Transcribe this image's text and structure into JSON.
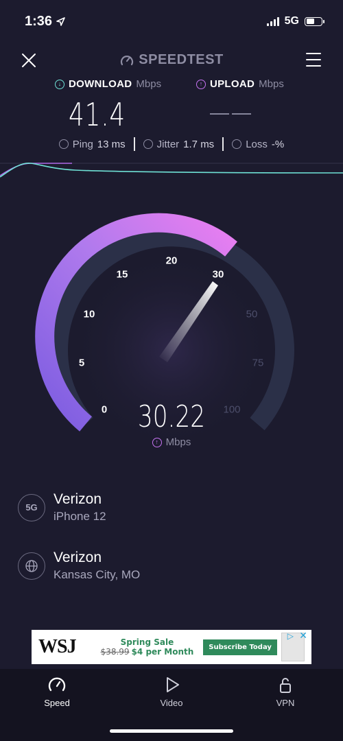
{
  "status_bar": {
    "time": "1:36",
    "network": "5G"
  },
  "header": {
    "app_name": "SPEEDTEST"
  },
  "download": {
    "label": "DOWNLOAD",
    "unit": "Mbps",
    "value": "41.4"
  },
  "upload": {
    "label": "UPLOAD",
    "unit": "Mbps",
    "value": "——"
  },
  "stats": {
    "ping_label": "Ping",
    "ping_value": "13 ms",
    "jitter_label": "Jitter",
    "jitter_value": "1.7 ms",
    "loss_label": "Loss",
    "loss_value": "-%"
  },
  "gauge": {
    "ticks": [
      "0",
      "5",
      "10",
      "15",
      "20",
      "30",
      "50",
      "75",
      "100"
    ],
    "current_speed": "30.22",
    "unit": "Mbps",
    "accent_start": "#7b5ce0",
    "accent_end": "#e879f0",
    "track_color": "#2b3048"
  },
  "connection": {
    "carrier": "Verizon",
    "device": "iPhone 12",
    "badge": "5G"
  },
  "server": {
    "provider": "Verizon",
    "location": "Kansas City, MO"
  },
  "ad": {
    "brand": "WSJ",
    "headline": "Spring Sale",
    "old_price": "$38.99",
    "new_price": "$4 per Month",
    "cta": "Subscribe Today"
  },
  "tabs": [
    {
      "label": "Speed",
      "icon": "gauge-icon",
      "active": true
    },
    {
      "label": "Video",
      "icon": "play-icon",
      "active": false
    },
    {
      "label": "VPN",
      "icon": "lock-icon",
      "active": false
    }
  ],
  "colors": {
    "background": "#1c1b2e",
    "download_accent": "#6fe2d6",
    "upload_accent": "#c774f2"
  }
}
